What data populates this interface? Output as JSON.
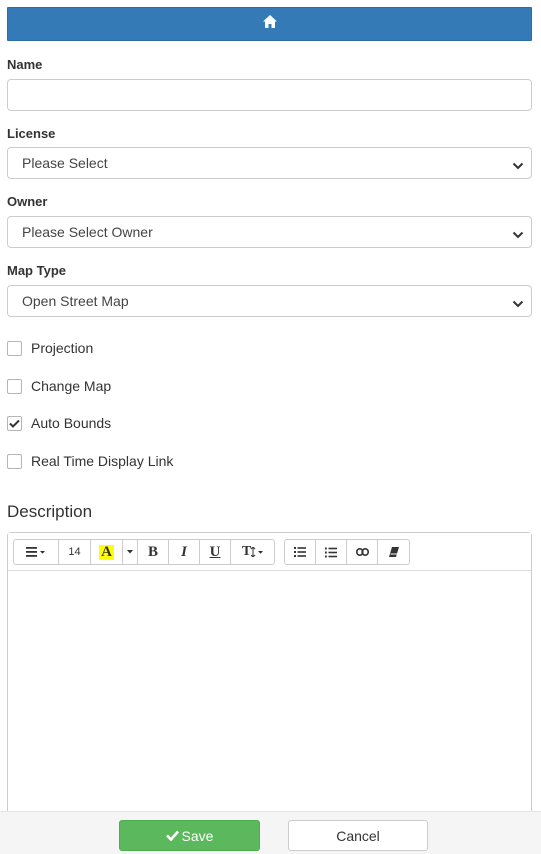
{
  "header": {
    "icon": "home-icon",
    "color": "#337ab7"
  },
  "form": {
    "name": {
      "label": "Name",
      "value": "",
      "placeholder": ""
    },
    "license": {
      "label": "License",
      "selected": "Please Select"
    },
    "owner": {
      "label": "Owner",
      "selected": "Please Select Owner"
    },
    "map_type": {
      "label": "Map Type",
      "selected": "Open Street Map"
    },
    "checkboxes": [
      {
        "label": "Projection",
        "checked": false
      },
      {
        "label": "Change Map",
        "checked": false
      },
      {
        "label": "Auto Bounds",
        "checked": true
      },
      {
        "label": "Real Time Display Link",
        "checked": false
      }
    ]
  },
  "description": {
    "title": "Description",
    "toolbar": {
      "font_size": "14",
      "highlight_glyph": "A",
      "bold": "B",
      "italic": "I",
      "underline": "U",
      "text_size_glyph": "T",
      "highlight_color": "#ffff00"
    },
    "content": ""
  },
  "footer": {
    "save_label": "Save",
    "cancel_label": "Cancel",
    "save_color": "#5cb85c"
  }
}
